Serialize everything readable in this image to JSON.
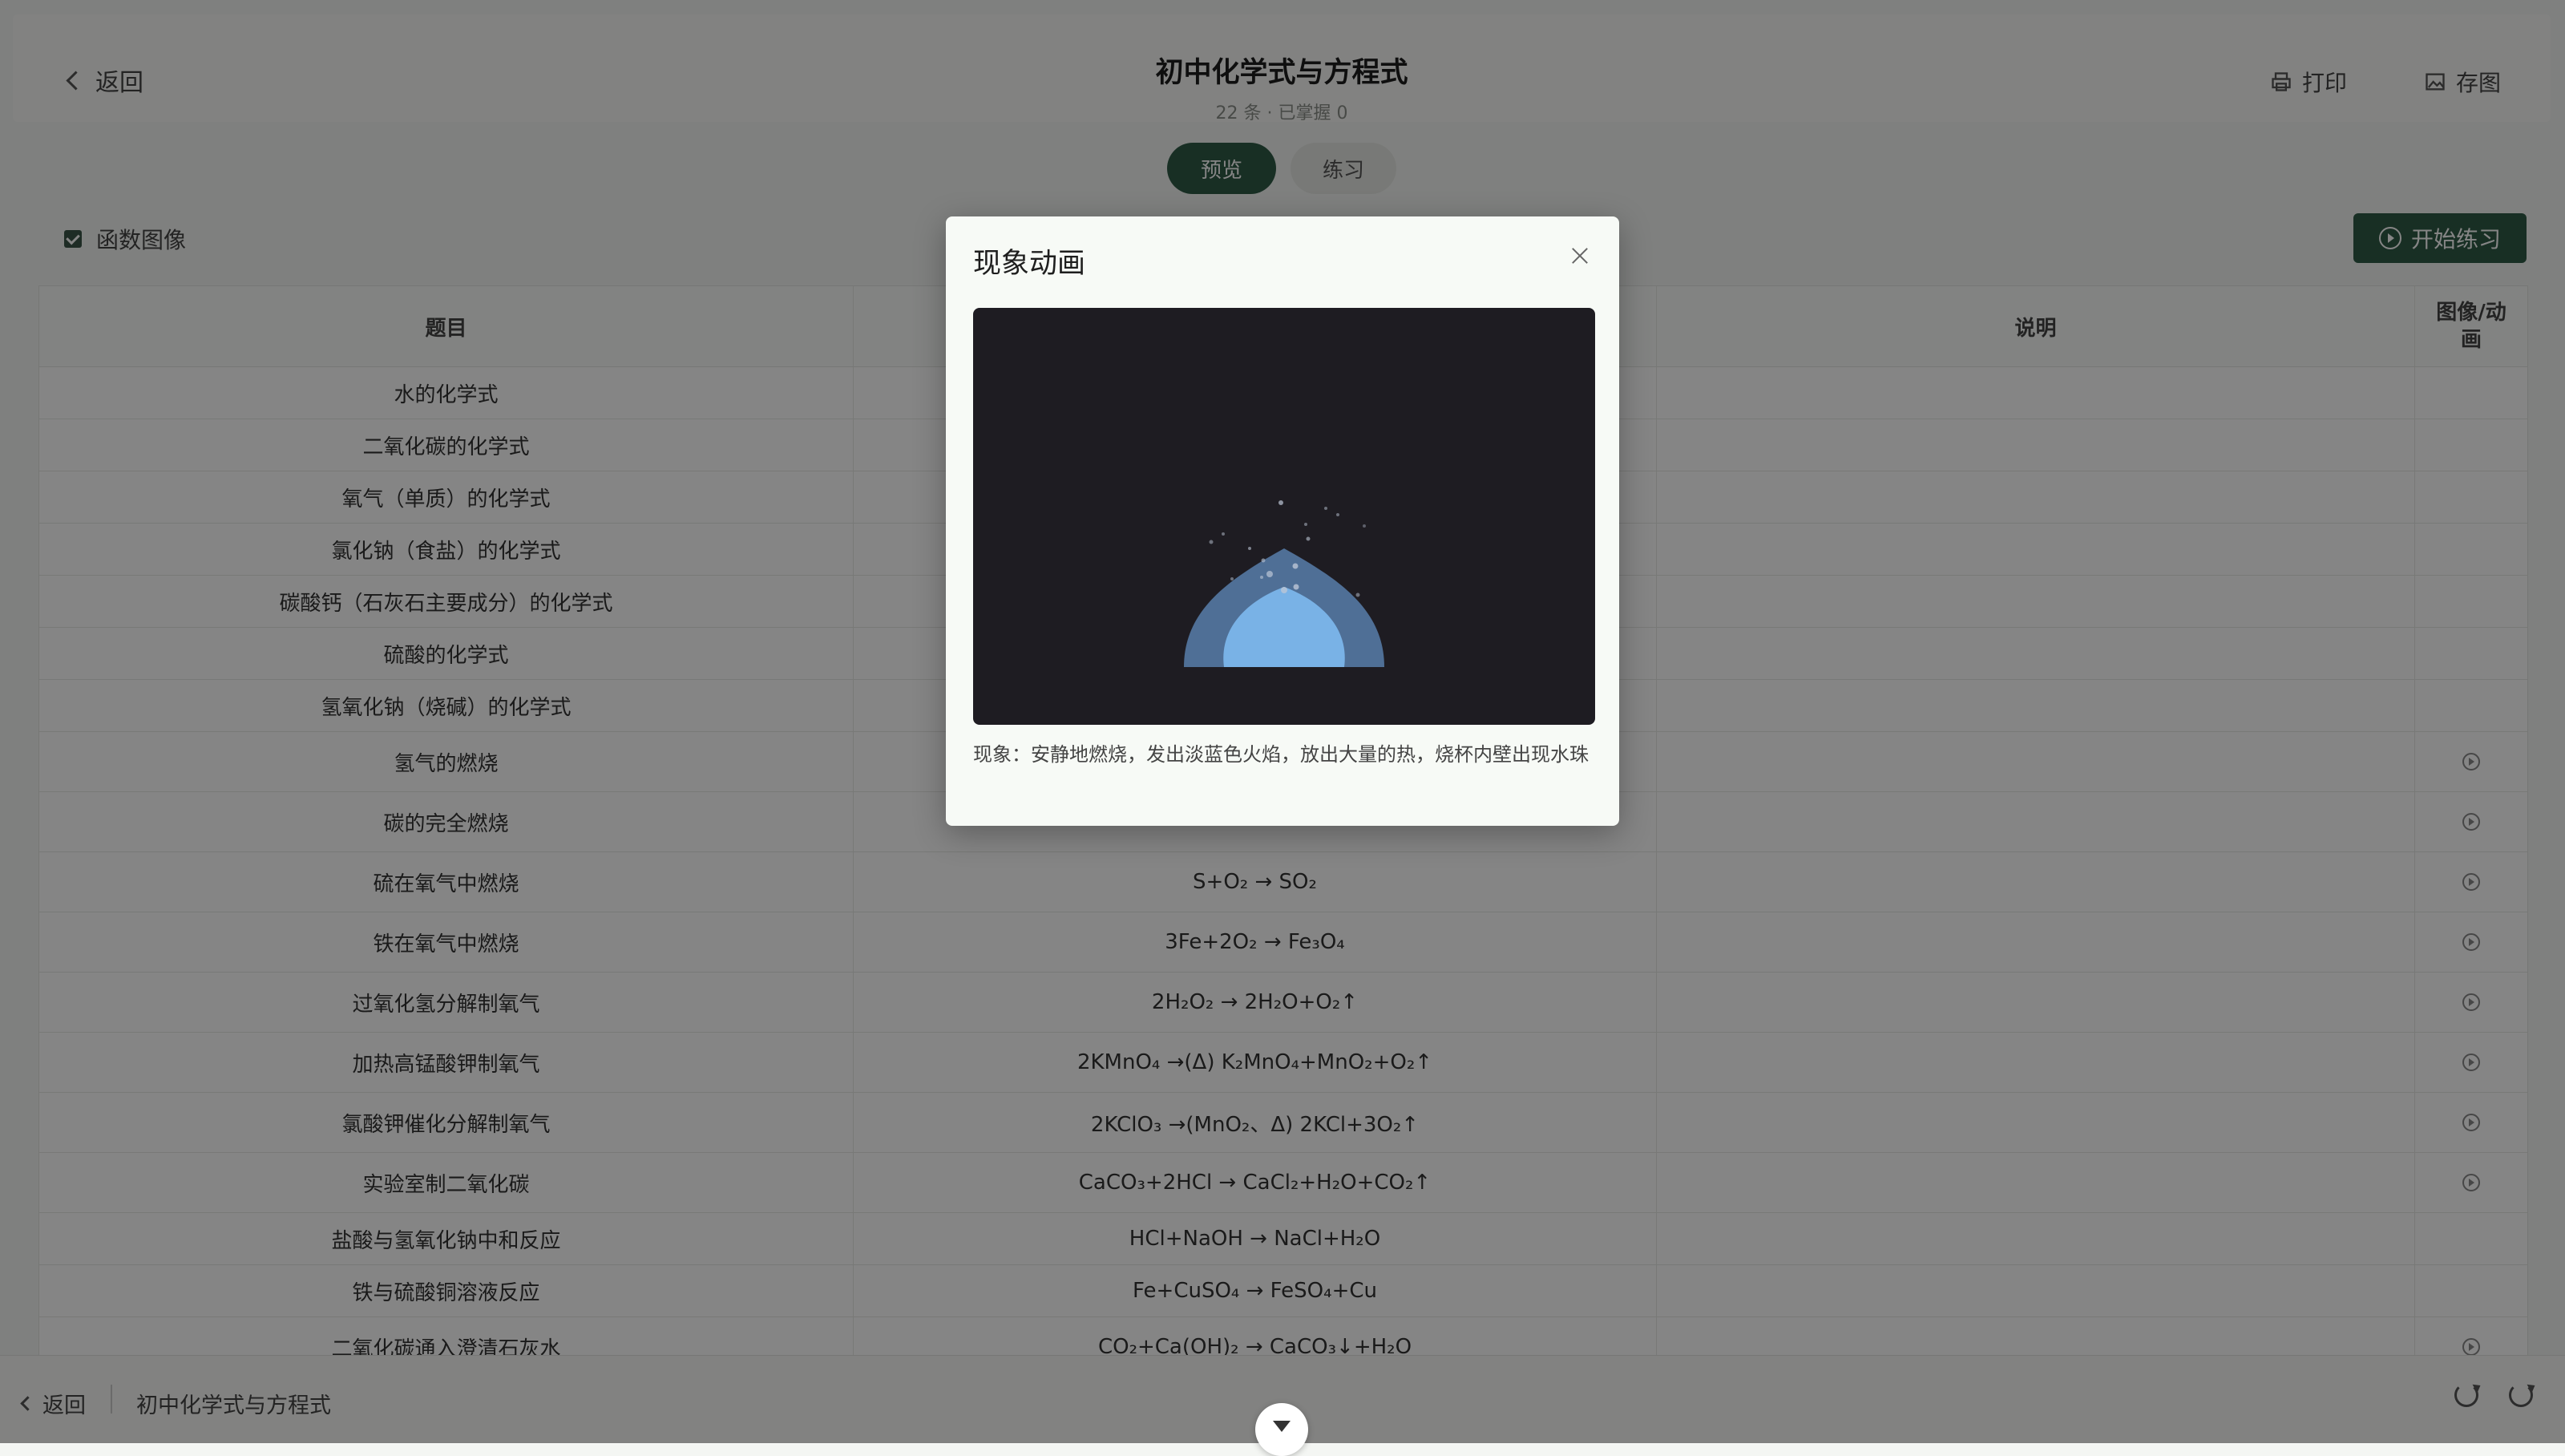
{
  "header": {
    "back_label": "返回",
    "title": "初中化学式与方程式",
    "subtitle": "22 条 · 已掌握 0",
    "print_label": "打印",
    "save_image_label": "存图"
  },
  "modes": {
    "preview_label": "预览",
    "practice_label": "练习"
  },
  "options": {
    "function_graph_label": "函数图像",
    "function_graph_checked": true
  },
  "start_button_label": "开始练习",
  "table": {
    "headers": [
      "题目",
      "",
      "说明",
      "图像/动画"
    ],
    "rows": [
      {
        "question": "水的化学式",
        "answer": "",
        "note": "",
        "has_animation": false
      },
      {
        "question": "二氧化碳的化学式",
        "answer": "",
        "note": "",
        "has_animation": false
      },
      {
        "question": "氧气（单质）的化学式",
        "answer": "",
        "note": "",
        "has_animation": false
      },
      {
        "question": "氯化钠（食盐）的化学式",
        "answer": "",
        "note": "",
        "has_animation": false
      },
      {
        "question": "碳酸钙（石灰石主要成分）的化学式",
        "answer": "",
        "note": "",
        "has_animation": false
      },
      {
        "question": "硫酸的化学式",
        "answer": "",
        "note": "",
        "has_animation": false
      },
      {
        "question": "氢氧化钠（烧碱）的化学式",
        "answer": "",
        "note": "",
        "has_animation": false
      },
      {
        "question": "氢气的燃烧",
        "answer": "",
        "note": "",
        "has_animation": true
      },
      {
        "question": "碳的完全燃烧",
        "answer": "",
        "note": "",
        "has_animation": true
      },
      {
        "question": "硫在氧气中燃烧",
        "answer": "S+O₂ → SO₂",
        "note": "",
        "has_animation": true
      },
      {
        "question": "铁在氧气中燃烧",
        "answer": "3Fe+2O₂ → Fe₃O₄",
        "note": "",
        "has_animation": true
      },
      {
        "question": "过氧化氢分解制氧气",
        "answer": "2H₂O₂ → 2H₂O+O₂↑",
        "note": "",
        "has_animation": true
      },
      {
        "question": "加热高锰酸钾制氧气",
        "answer": "2KMnO₄ →(Δ) K₂MnO₄+MnO₂+O₂↑",
        "note": "",
        "has_animation": true
      },
      {
        "question": "氯酸钾催化分解制氧气",
        "answer": "2KClO₃ →(MnO₂、Δ) 2KCl+3O₂↑",
        "note": "",
        "has_animation": true
      },
      {
        "question": "实验室制二氧化碳",
        "answer": "CaCO₃+2HCl → CaCl₂+H₂O+CO₂↑",
        "note": "",
        "has_animation": true
      },
      {
        "question": "盐酸与氢氧化钠中和反应",
        "answer": "HCl+NaOH → NaCl+H₂O",
        "note": "",
        "has_animation": false
      },
      {
        "question": "铁与硫酸铜溶液反应",
        "answer": "Fe+CuSO₄ → FeSO₄+Cu",
        "note": "",
        "has_animation": false
      },
      {
        "question": "二氧化碳通入澄清石灰水",
        "answer": "CO₂+Ca(OH)₂ → CaCO₃↓+H₂O",
        "note": "",
        "has_animation": true
      }
    ]
  },
  "modal": {
    "title": "现象动画",
    "caption": "现象：安静地燃烧，发出淡蓝色火焰，放出大量的热，烧杯内壁出现水珠",
    "flame_outer_color": "#4f6f96",
    "flame_inner_color": "#79b2e6",
    "background_color": "#1e1c22"
  },
  "bottom_bar": {
    "back_label": "返回",
    "title": "初中化学式与方程式"
  }
}
